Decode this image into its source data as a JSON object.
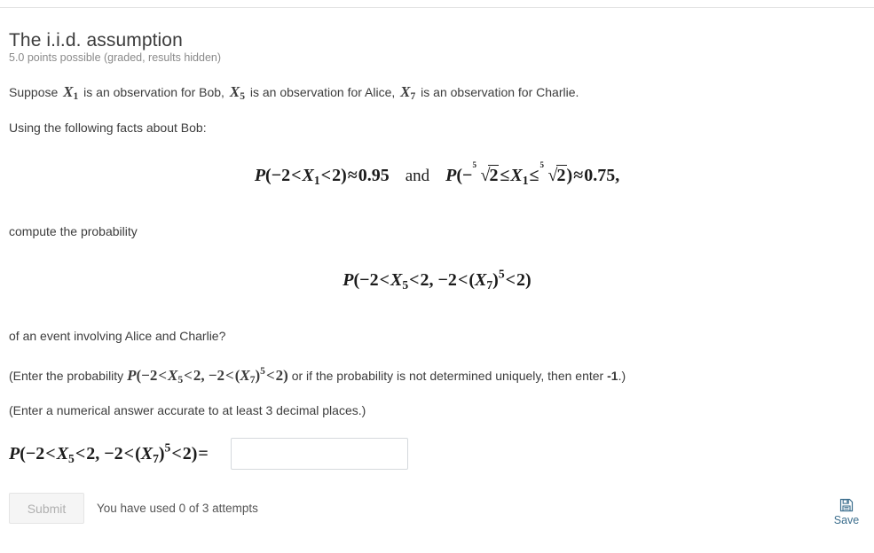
{
  "problem": {
    "title": "The i.i.d. assumption",
    "points_line": "5.0 points possible (graded, results hidden)",
    "setup": {
      "text_a": "Suppose ",
      "var_1": "X",
      "var_1_sub": "1",
      "text_b": " is an observation for Bob, ",
      "var_2": "X",
      "var_2_sub": "5",
      "text_c": " is an observation for Alice, ",
      "var_3": "X",
      "var_3_sub": "7",
      "text_d": " is an observation for Charlie."
    },
    "facts_intro": "Using the following facts about Bob:",
    "compute_intro": "compute the probability",
    "event_question": "of an event involving Alice and Charlie?",
    "enter_line_1": {
      "prefix": "(Enter the probability ",
      "suffix": " or if the probability is not determined uniquely, then enter ",
      "bold_value": "-1",
      "tail": ".)"
    },
    "enter_line_2": "(Enter a numerical answer accurate to at least 3 decimal places.)"
  },
  "equations": {
    "facts": {
      "first": {
        "P": "P",
        "open": "(",
        "lower": "−2",
        "rel1": "<",
        "var": "X",
        "var_sub": "1",
        "rel2": "<",
        "upper": "2",
        "close": ")",
        "approx": "≈",
        "value": "0.95"
      },
      "conjunction": "and",
      "second": {
        "P": "P",
        "open": "(",
        "minus": "−",
        "radical_index": "5",
        "radical_sign": "√",
        "radicand": "2",
        "rel1": "≤",
        "var": "X",
        "var_sub": "1",
        "rel2": "≤",
        "close": ")",
        "approx": "≈",
        "value": "0.75,"
      }
    },
    "target": {
      "P": "P",
      "open": "(",
      "lower_a": "−2",
      "rel_a1": "<",
      "var_a": "X",
      "var_a_sub": "5",
      "rel_a2": "<",
      "upper_a": "2,",
      "lower_b": "−2",
      "rel_b1": "<",
      "pow_open": "(",
      "var_b": "X",
      "var_b_sub": "7",
      "pow_close": ")",
      "exponent": "5",
      "rel_b2": "<",
      "upper_b": "2",
      "close": ")"
    },
    "answer_equals": "="
  },
  "answer_field": {
    "value": "",
    "placeholder": ""
  },
  "footer": {
    "submit_label": "Submit",
    "attempts_text": "You have used 0 of 3 attempts",
    "save_label": "Save",
    "save_icon": "floppy-disk-icon"
  },
  "colors": {
    "text": "#3c3c3c",
    "muted": "#8a8a8a",
    "math": "#1b1b1b",
    "accent_blue": "#3d6f8e",
    "border": "#d5d9dd",
    "rule": "#e3e3e3",
    "submit_bg": "#f5f5f5",
    "submit_text": "#b0b0b0"
  }
}
